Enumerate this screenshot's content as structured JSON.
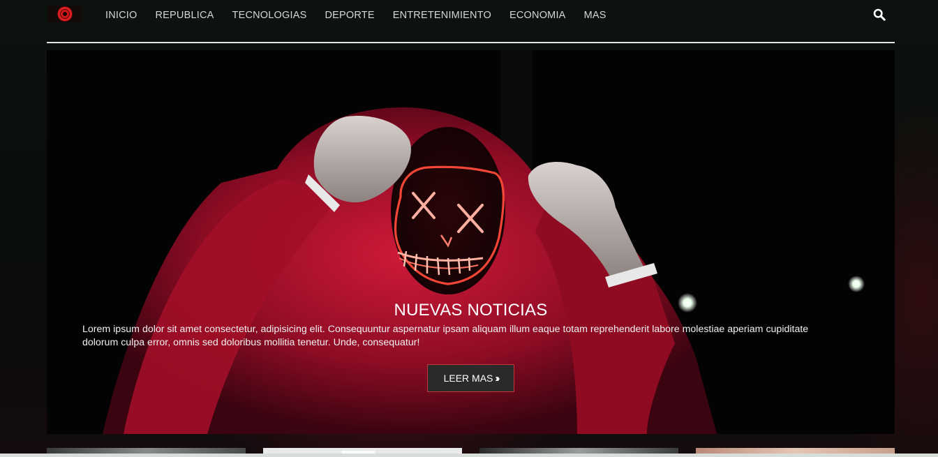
{
  "nav": {
    "items": [
      {
        "label": "INICIO"
      },
      {
        "label": "REPUBLICA"
      },
      {
        "label": "TECNOLOGIAS"
      },
      {
        "label": "DEPORTE"
      },
      {
        "label": "ENTRETENIMIENTO"
      },
      {
        "label": "ECONOMIA"
      },
      {
        "label": "MAS"
      }
    ],
    "search_icon": "search-icon"
  },
  "hero": {
    "title": "NUEVAS NOTICIAS",
    "text": "Lorem ipsum dolor sit amet consectetur, adipisicing elit. Consequuntur aspernatur ipsam aliquam illum eaque totam reprehenderit labore molestiae aperiam cupiditate dolorum culpa error, omnis sed doloribus mollitia tenetur. Unde, consequatur!",
    "button_label": "LEER MAS",
    "button_icon": "double-chevron-right-icon"
  },
  "colors": {
    "accent": "#c23a3a",
    "hoodie_red": "#b0102c",
    "mask_glow": "#ff3b3b"
  }
}
